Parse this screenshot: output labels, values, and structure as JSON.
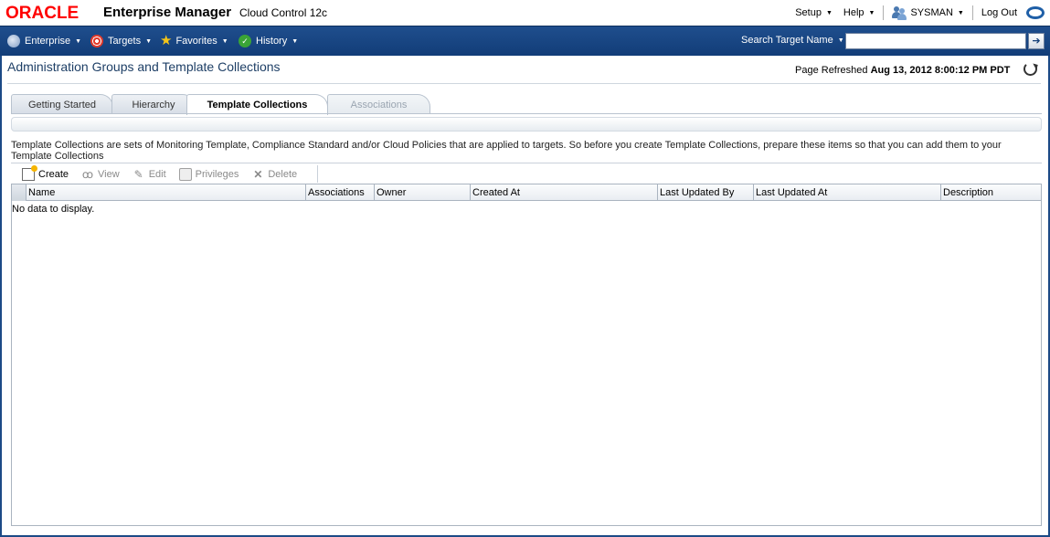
{
  "brand": {
    "oracle": "ORACLE",
    "product": "Enterprise Manager",
    "edition": "Cloud Control 12c"
  },
  "global_links": {
    "setup": "Setup",
    "help": "Help",
    "user": "SYSMAN",
    "logout": "Log Out"
  },
  "menu": {
    "enterprise": "Enterprise",
    "targets": "Targets",
    "favorites": "Favorites",
    "history": "History",
    "search_label": "Search Target Name",
    "search_value": ""
  },
  "page": {
    "title": "Administration Groups and Template Collections",
    "refresh_prefix": "Page Refreshed",
    "refresh_time": "Aug 13, 2012 8:00:12 PM PDT"
  },
  "tabs": [
    {
      "label": "Getting Started",
      "state": "normal"
    },
    {
      "label": "Hierarchy",
      "state": "normal"
    },
    {
      "label": "Template Collections",
      "state": "active"
    },
    {
      "label": "Associations",
      "state": "disabled"
    }
  ],
  "description": "Template Collections are sets of Monitoring Template, Compliance Standard and/or Cloud Policies that are applied to targets. So before you create Template Collections, prepare these items so that you can add them to your Template Collections",
  "toolbar": {
    "create": "Create",
    "view": "View",
    "edit": "Edit",
    "privileges": "Privileges",
    "delete": "Delete"
  },
  "table": {
    "columns": [
      "Name",
      "Associations",
      "Owner",
      "Created At",
      "Last Updated By",
      "Last Updated At",
      "Description"
    ],
    "empty_text": "No data to display."
  },
  "colors": {
    "menubar": "#1f4e8d",
    "oracle_red": "#ff0000",
    "title_blue": "#1e3f66"
  }
}
